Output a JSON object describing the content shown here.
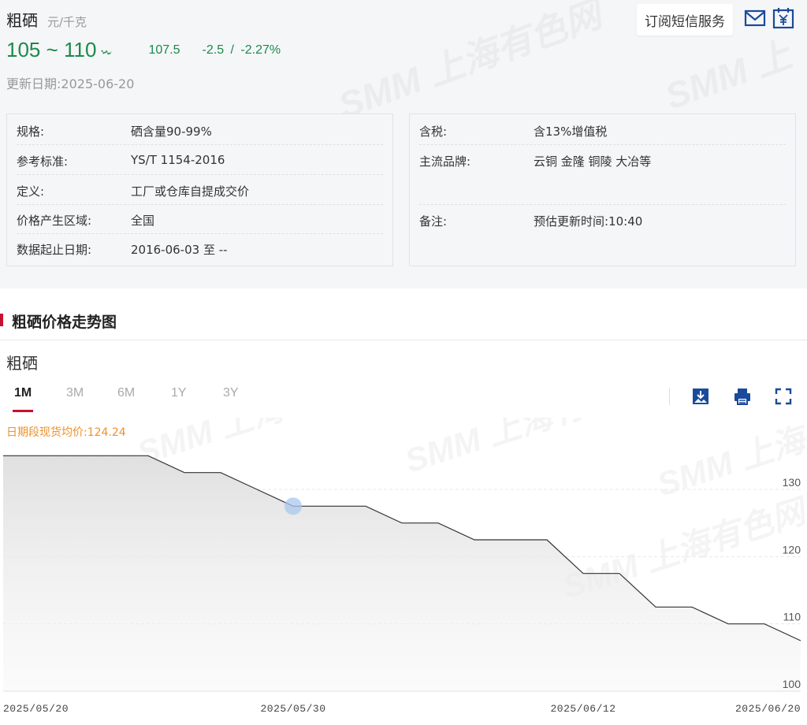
{
  "product": {
    "name": "粗硒",
    "unit": "元/千克",
    "price_range": "105 ~ 110",
    "average": "107.5",
    "change": "-2.5 / -2.27%",
    "update_label": "更新日期:",
    "update_date": "2025-06-20"
  },
  "actions": {
    "subscribe_label": "订阅短信服务"
  },
  "info_left": [
    {
      "label": "规格:",
      "value": "硒含量90-99%"
    },
    {
      "label": "参考标准:",
      "value": "YS/T 1154-2016"
    },
    {
      "label": "定义:",
      "value": "工厂或仓库自提成交价"
    },
    {
      "label": "价格产生区域:",
      "value": "全国"
    },
    {
      "label": "数据起止日期:",
      "value": "2016-06-03 至 --"
    }
  ],
  "info_right": [
    {
      "label": "含税:",
      "value": "含13%增值税"
    },
    {
      "label": "主流品牌:",
      "value": "云铜 金隆 铜陵 大冶等"
    },
    {
      "label": "备注:",
      "value": "预估更新时间:10:40"
    }
  ],
  "section": {
    "title": "粗硒价格走势图"
  },
  "chart": {
    "title": "粗硒",
    "tabs": [
      "1M",
      "3M",
      "6M",
      "1Y",
      "3Y"
    ],
    "active_tab": "1M",
    "avg_label": "日期段现货均价:124.24",
    "watermark": "SMM 上海有色网"
  },
  "colors": {
    "up_down": "#1a8a4a",
    "accent": "#c8102e",
    "avg_label": "#f0902a",
    "line": "#333333",
    "hover_point": "#a8c8ee",
    "icon_blue": "#1a4a9c"
  },
  "icons": [
    "mail-icon",
    "calendar-yuan-icon",
    "download-image-icon",
    "print-icon",
    "fullscreen-icon",
    "trend-down-icon"
  ],
  "chart_data": {
    "type": "area",
    "x": [
      "2025/05/20",
      "2025/05/21",
      "2025/05/22",
      "2025/05/23",
      "2025/05/26",
      "2025/05/27",
      "2025/05/28",
      "2025/05/29",
      "2025/05/30",
      "2025/06/03",
      "2025/06/04",
      "2025/06/05",
      "2025/06/06",
      "2025/06/09",
      "2025/06/10",
      "2025/06/11",
      "2025/06/12",
      "2025/06/13",
      "2025/06/16",
      "2025/06/17",
      "2025/06/18",
      "2025/06/19",
      "2025/06/20"
    ],
    "series": [
      {
        "values": [
          135,
          135,
          135,
          135,
          135,
          132.5,
          132.5,
          130,
          127.5,
          127.5,
          127.5,
          125,
          125,
          122.5,
          122.5,
          122.5,
          117.5,
          117.5,
          112.5,
          112.5,
          110,
          110,
          107.5
        ]
      }
    ],
    "x_tick_labels": [
      "2025/05/20",
      "2025/05/30",
      "2025/06/12",
      "2025/06/20"
    ],
    "y_tick_labels": [
      "100",
      "110",
      "120",
      "130"
    ],
    "ylim": [
      100,
      137.5
    ],
    "y_axis_position": "right",
    "grid": true,
    "annotation": "日期段现货均价:124.24",
    "highlighted_point": {
      "x": "2025/05/30",
      "y": 127.5
    }
  }
}
